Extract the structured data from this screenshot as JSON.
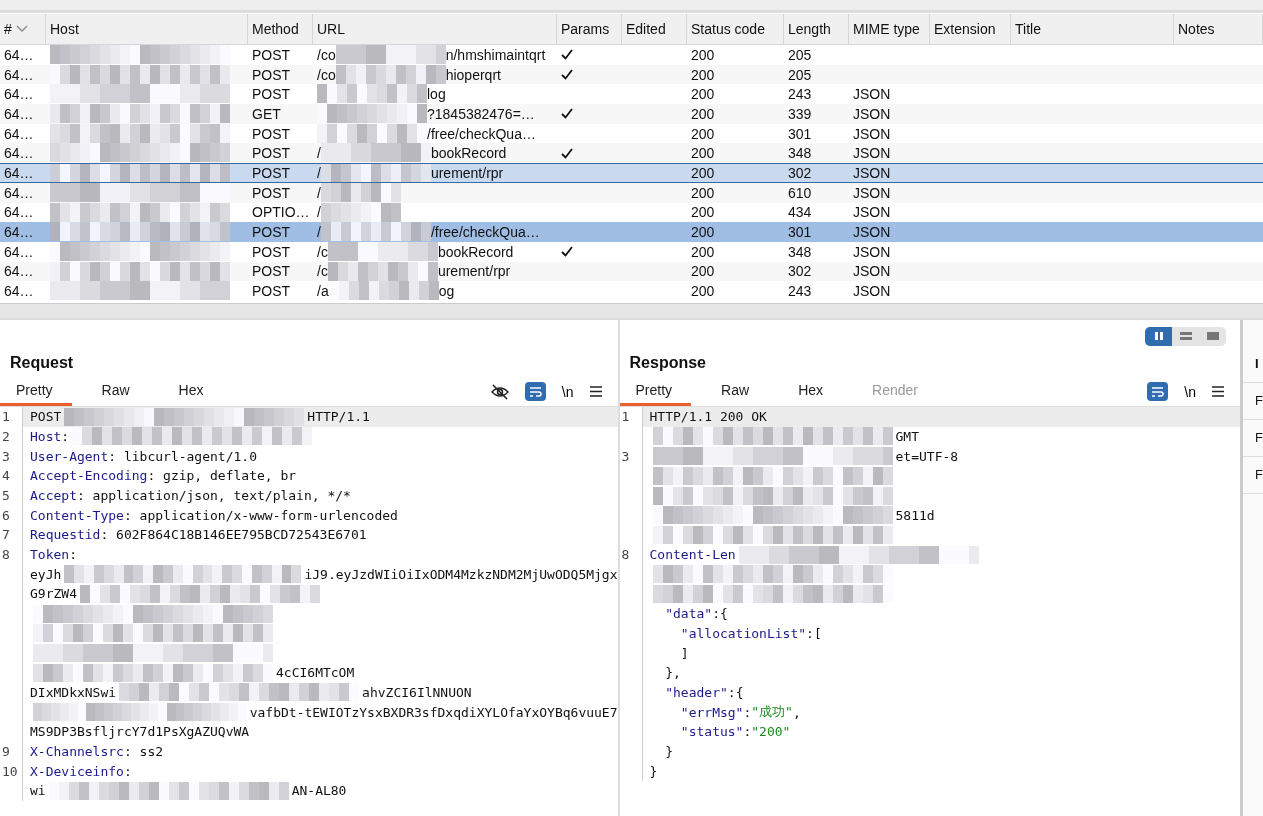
{
  "table": {
    "columns": [
      {
        "label": "#",
        "sort": true
      },
      {
        "label": "Host"
      },
      {
        "label": "Method"
      },
      {
        "label": "URL"
      },
      {
        "label": "Params"
      },
      {
        "label": "Edited"
      },
      {
        "label": "Status code"
      },
      {
        "label": "Length"
      },
      {
        "label": "MIME type"
      },
      {
        "label": "Extension"
      },
      {
        "label": "Title"
      },
      {
        "label": "Notes"
      }
    ],
    "rows": [
      {
        "num": "64…",
        "method": "POST",
        "url_head": "/co",
        "url_tail": "n/hmshimaintqrt",
        "params": true,
        "status": "200",
        "length": "205",
        "selected": false,
        "focused": false
      },
      {
        "num": "64…",
        "method": "POST",
        "url_head": "/co",
        "url_tail": "hioperqrt",
        "params": true,
        "status": "200",
        "length": "205",
        "selected": false,
        "focused": false
      },
      {
        "num": "64…",
        "method": "POST",
        "url_tail": "log",
        "params": false,
        "status": "200",
        "length": "243",
        "mime": "JSON",
        "selected": false,
        "focused": false
      },
      {
        "num": "64…",
        "method": "GET",
        "url_tail": "?1845382476=…",
        "params": true,
        "status": "200",
        "length": "339",
        "mime": "JSON",
        "selected": false,
        "focused": false
      },
      {
        "num": "64…",
        "method": "POST",
        "url_tail": "/free/checkQua…",
        "params": false,
        "status": "200",
        "length": "301",
        "mime": "JSON",
        "selected": false,
        "focused": false
      },
      {
        "num": "64…",
        "method": "POST",
        "url_head": "/",
        "url_tail": "bookRecord",
        "params": true,
        "status": "200",
        "length": "348",
        "mime": "JSON",
        "selected": false,
        "focused": false
      },
      {
        "num": "64…",
        "method": "POST",
        "url_head": "/",
        "url_tail": "urement/rpr",
        "params": false,
        "status": "200",
        "length": "302",
        "mime": "JSON",
        "selected": false,
        "focused": true
      },
      {
        "num": "64…",
        "method": "POST",
        "url_head": "/",
        "params": false,
        "status": "200",
        "length": "610",
        "mime": "JSON",
        "selected": false,
        "focused": false
      },
      {
        "num": "64…",
        "method": "OPTIO…",
        "url_head": "/",
        "params": false,
        "status": "200",
        "length": "434",
        "mime": "JSON",
        "selected": false,
        "focused": false
      },
      {
        "num": "64…",
        "method": "POST",
        "url_head": "/",
        "url_tail": "/free/checkQua…",
        "params": false,
        "status": "200",
        "length": "301",
        "mime": "JSON",
        "selected": true,
        "focused": false
      },
      {
        "num": "64…",
        "method": "POST",
        "url_head": "/c",
        "url_tail": "bookRecord",
        "params": true,
        "status": "200",
        "length": "348",
        "mime": "JSON",
        "selected": false,
        "focused": false
      },
      {
        "num": "64…",
        "method": "POST",
        "url_head": "/c",
        "url_tail": "urement/rpr",
        "params": false,
        "status": "200",
        "length": "302",
        "mime": "JSON",
        "selected": false,
        "focused": false
      },
      {
        "num": "64…",
        "method": "POST",
        "url_head": "/a",
        "url_tail": "og",
        "params": false,
        "status": "200",
        "length": "243",
        "mime": "JSON",
        "selected": false,
        "focused": false
      }
    ]
  },
  "request": {
    "title": "Request",
    "tabs": [
      {
        "label": "Pretty",
        "selected": true
      },
      {
        "label": "Raw",
        "selected": false
      },
      {
        "label": "Hex",
        "selected": false
      }
    ],
    "newline_label": "\\n",
    "lines": [
      {
        "num": "1",
        "text": "POST",
        "tail": "HTTP/1.1",
        "redacted": true,
        "current": true
      },
      {
        "num": "2",
        "key": "Host",
        "text": ":",
        "redacted": true
      },
      {
        "num": "3",
        "key": "User-Agent",
        "text": ": libcurl-agent/1.0"
      },
      {
        "num": "4",
        "key": "Accept-Encoding",
        "text": ": gzip, deflate, br"
      },
      {
        "num": "5",
        "key": "Accept",
        "text": ": application/json, text/plain, */*"
      },
      {
        "num": "6",
        "key": "Content-Type",
        "text": ": application/x-www-form-urlencoded"
      },
      {
        "num": "7",
        "key": "Requestid",
        "text": ": 602F864C18B146EE795BCD72543E6701"
      },
      {
        "num": "8",
        "key": "Token",
        "text": ":"
      },
      {
        "text": "eyJh",
        "tail": "iJ9.eyJzdWIiOiIxODM4MzkzNDM2MjUwODQ5Mjgx",
        "redacted": true
      },
      {
        "text": "G9rZW4",
        "redacted": true
      },
      {
        "redacted": true
      },
      {
        "redacted": true
      },
      {
        "redacted": true
      },
      {
        "tail": "4cCI6MTcOM",
        "redacted": true
      },
      {
        "text": "DIxMDkxNSwi",
        "tail": "ahvZCI6IlNNUON",
        "redacted": true
      },
      {
        "tail": "vafbDt-tEWIOTzYsxBXDR3sfDxqdiXYLOfaYxOYBq6vuuE7",
        "redacted": true
      },
      {
        "text": "MS9DP3BsfljrcY7d1PsXgAZUQvWA"
      },
      {
        "num": "9",
        "key": "X-Channelsrc",
        "text": ": ss2"
      },
      {
        "num": "10",
        "key": "X-Deviceinfo",
        "text": ":"
      },
      {
        "text": "wi",
        "tail": "AN-AL80",
        "redacted": true
      }
    ]
  },
  "response": {
    "title": "Response",
    "tabs": [
      {
        "label": "Pretty",
        "selected": true,
        "disabled": false
      },
      {
        "label": "Raw",
        "selected": false,
        "disabled": false
      },
      {
        "label": "Hex",
        "selected": false,
        "disabled": false
      },
      {
        "label": "Render",
        "selected": false,
        "disabled": true
      }
    ],
    "newline_label": "\\n",
    "layout_buttons": [
      {
        "kind": "columns",
        "selected": true
      },
      {
        "kind": "rows",
        "selected": false
      },
      {
        "kind": "single",
        "selected": false
      }
    ],
    "lines": [
      {
        "num": "1",
        "text": "HTTP/1.1 200 OK",
        "current": true
      },
      {
        "tail": "GMT",
        "redacted": true
      },
      {
        "num": "3",
        "tail": "et=UTF-8",
        "redacted": true
      },
      {
        "redacted": true
      },
      {
        "redacted": true
      },
      {
        "tail": "5811d",
        "redacted": true
      },
      {
        "redacted": true
      },
      {
        "num": "8",
        "key": "Content-Len",
        "redacted": true
      },
      {
        "redacted": true
      },
      {
        "redacted": true
      },
      {
        "key": "  \"data\"",
        "text": ":{"
      },
      {
        "key": "    \"allocationList\"",
        "text": ":["
      },
      {
        "text": "    ]"
      },
      {
        "text": "  },"
      },
      {
        "key": "  \"header\"",
        "text": ":{"
      },
      {
        "key": "    \"errMsg\"",
        "text": ":",
        "value": "\"成功\"",
        "tail": ","
      },
      {
        "key": "    \"status\"",
        "text": ":",
        "value": "\"200\""
      },
      {
        "text": "  }"
      },
      {
        "text": "}"
      }
    ]
  },
  "inspector": {
    "labels": [
      "I",
      "F",
      "F",
      "F"
    ]
  }
}
